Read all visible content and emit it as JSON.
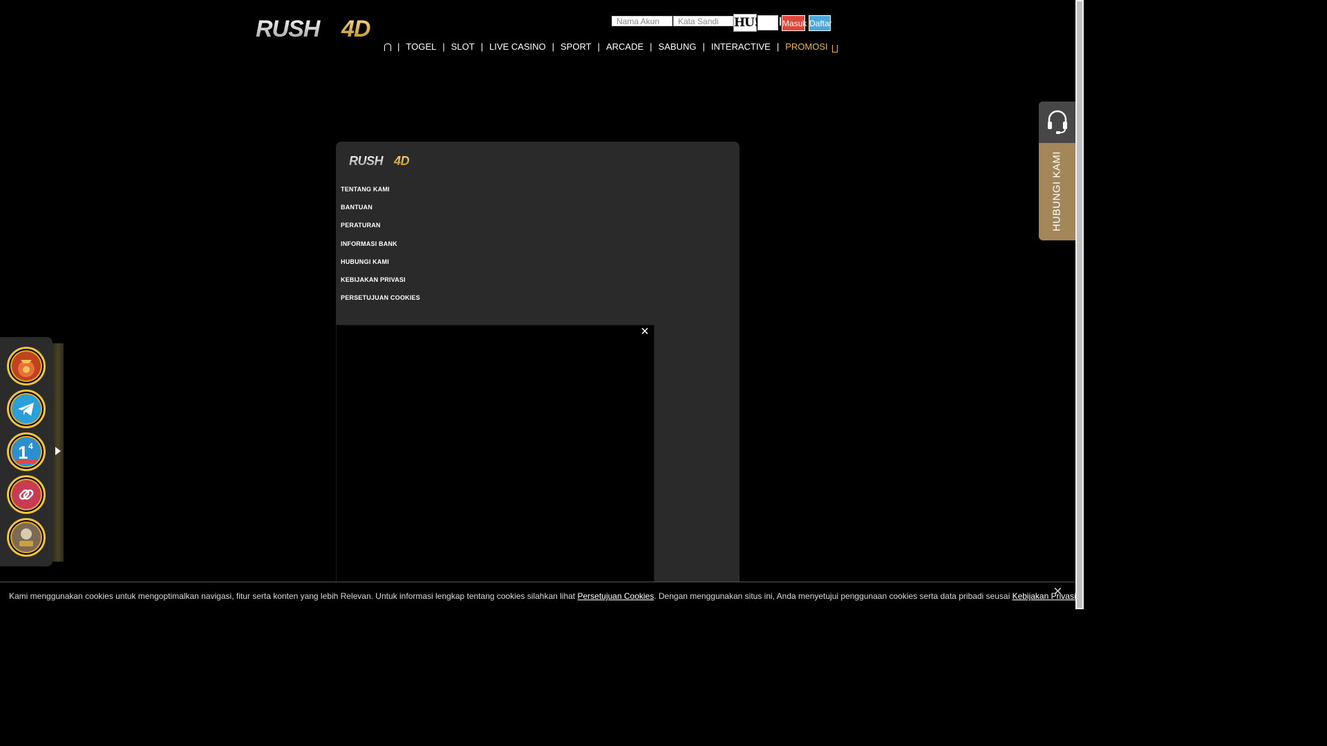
{
  "header": {
    "logo_text": "RUSH4D",
    "login": {
      "username_placeholder": "Nama Akun",
      "password_placeholder": "Kata Sandi",
      "captcha_text": "HU!",
      "login_button": "Masuk",
      "register_button": "Daftar"
    },
    "nav": {
      "items": [
        "TOGEL",
        "SLOT",
        "LIVE CASINO",
        "SPORT",
        "ARCADE",
        "SABUNG",
        "INTERACTIVE"
      ],
      "promo": "PROMOSI"
    }
  },
  "footer_panel": {
    "logo_text": "RUSH4D",
    "links": [
      "TENTANG KAMI",
      "BANTUAN",
      "PERATURAN",
      "INFORMASI BANK",
      "HUBUNGI KAMI",
      "KEBIJAKAN PRIVASI",
      "PERSETUJUAN COOKIES"
    ],
    "video_close": "×"
  },
  "contact_tab": {
    "label": "HUBUNGI KAMI"
  },
  "float_bar": {
    "icons": [
      "lucky-bag-icon",
      "telegram-icon",
      "anniversary-icon",
      "link-icon",
      "jackpot-icon"
    ],
    "colors": {
      "lucky-bag-icon": "#c0421f",
      "telegram-icon": "#2aa0da",
      "anniversary-icon": "#2b8fd0",
      "link-icon": "#c93a55",
      "jackpot-icon": "#7d6a55"
    }
  },
  "cookie_bar": {
    "text_1": "Kami menggunakan cookies untuk mengoptimalkan navigasi, fitur serta konten yang lebih Relevan. Untuk informasi lengkap tentang cookies silahkan lihat ",
    "link_1": "Persetujuan Cookies",
    "text_2": ". Dengan menggunakan situs ini, Anda menyetujui penggunaan cookies serta data pribadi seusai ",
    "link_2": "Kebijakan Privasi",
    "text_3": ".",
    "close": "×"
  },
  "colors": {
    "promo": "#f2b63a",
    "login_button": "#e0453a",
    "register_button": "#4aa9d8",
    "contact_tab": "#a3865a",
    "panel_bg": "#2a2a2a"
  }
}
